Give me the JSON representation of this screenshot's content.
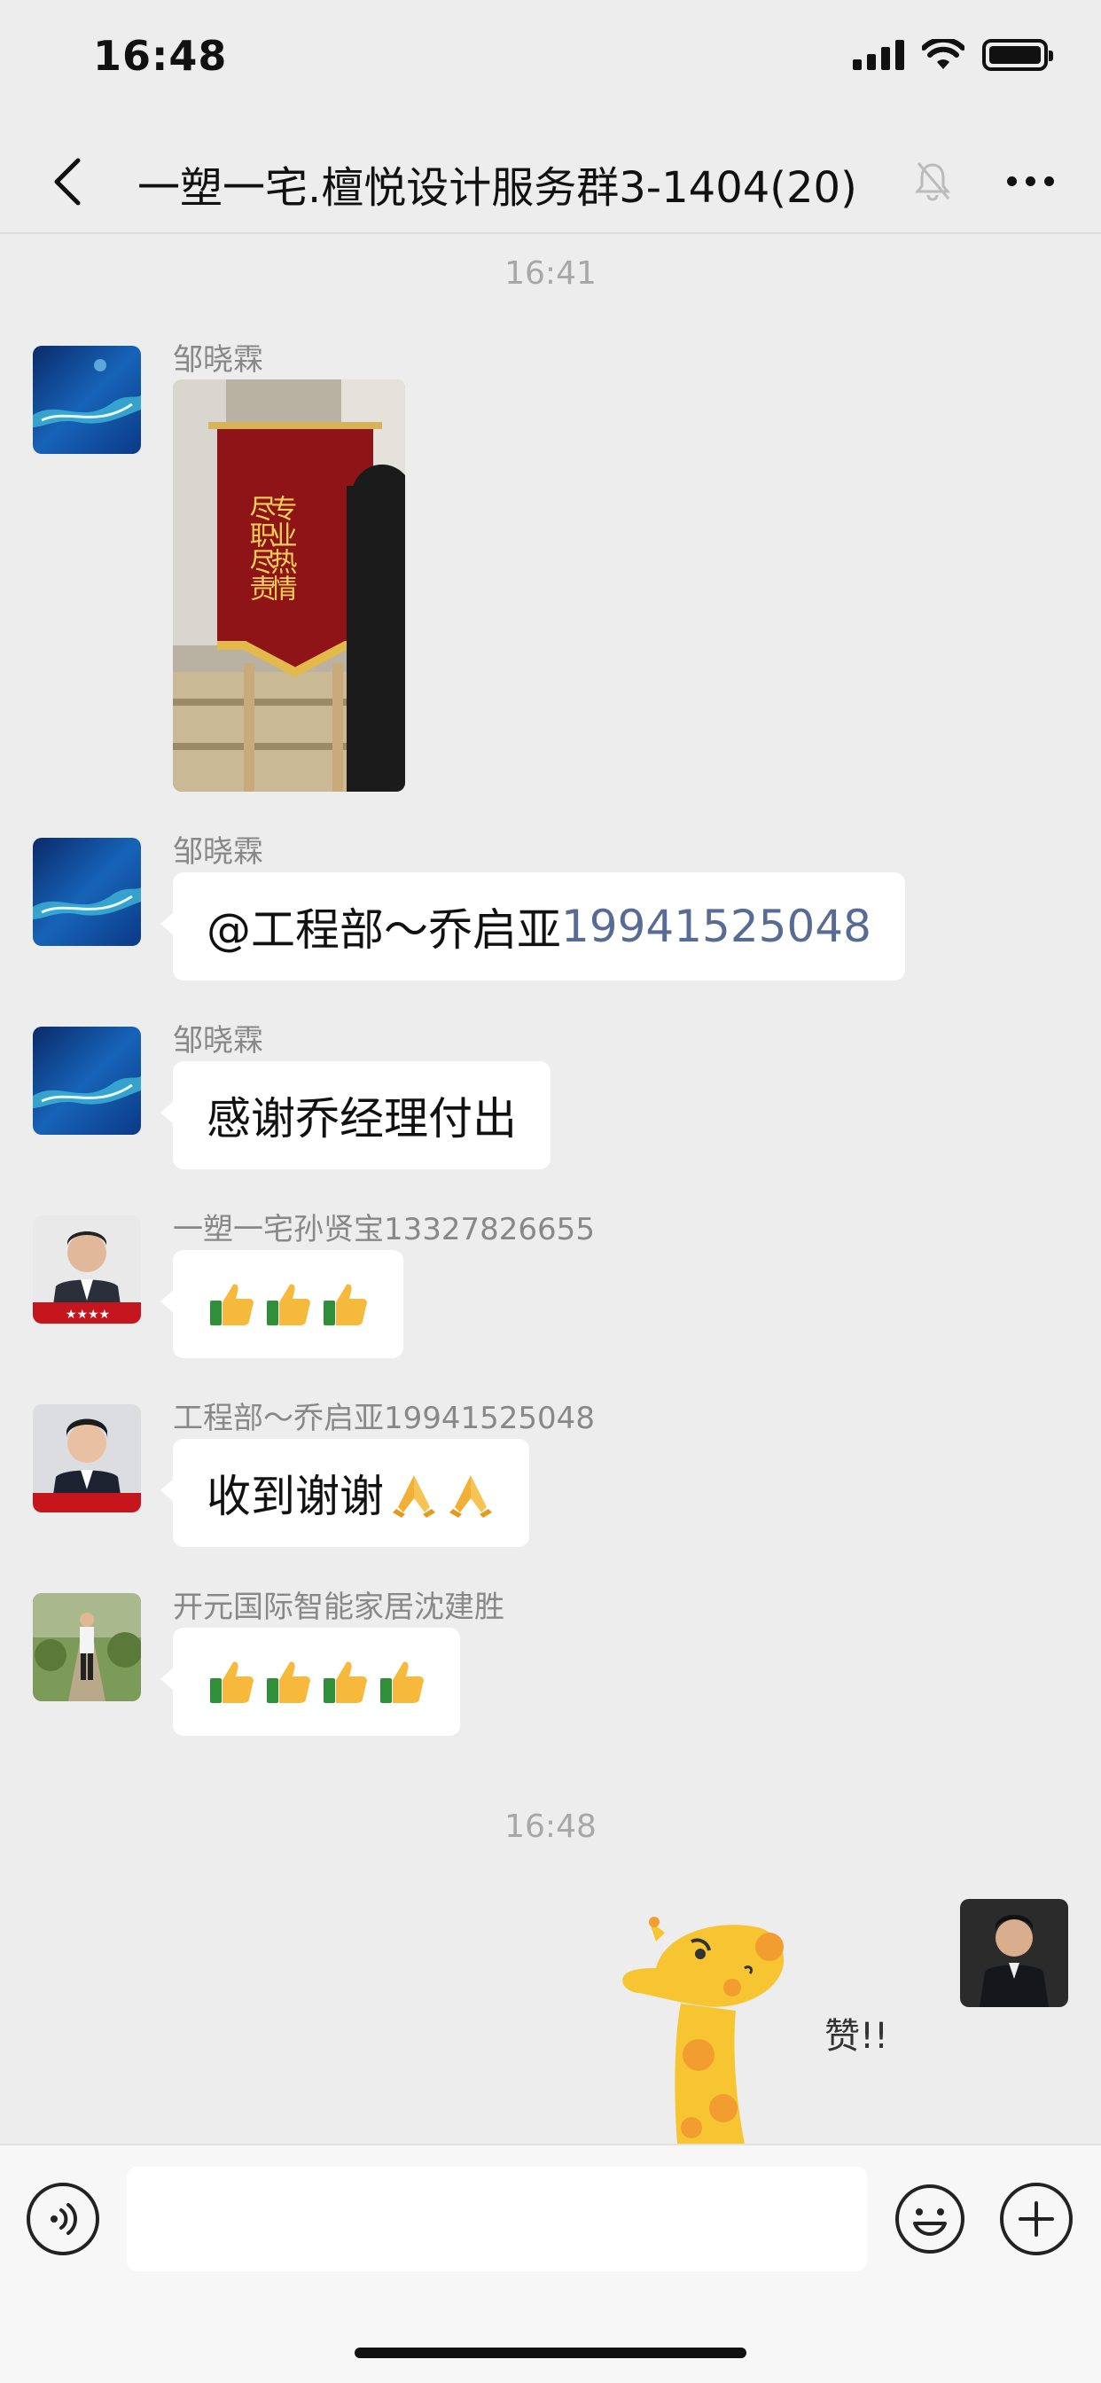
{
  "status_bar": {
    "time": "16:48"
  },
  "header": {
    "title": "一塑一宅.檀悦设计服务群3-1404(20)"
  },
  "timestamps": [
    "16:41",
    "16:48"
  ],
  "messages": [
    {
      "sender": "邹晓霖",
      "type": "image"
    },
    {
      "sender": "邹晓霖",
      "text": "@工程部～乔启亚",
      "mention_number": "19941525048"
    },
    {
      "sender": "邹晓霖",
      "text": "感谢乔经理付出"
    },
    {
      "sender": "一塑一宅孙贤宝13327826655",
      "emoji": [
        "thumbs-up",
        "thumbs-up",
        "thumbs-up"
      ]
    },
    {
      "sender": "工程部～乔启亚19941525048",
      "text": "收到谢谢",
      "emoji": [
        "folded-hands",
        "folded-hands"
      ]
    },
    {
      "sender": "开元国际智能家居沈建胜",
      "emoji": [
        "thumbs-up",
        "thumbs-up",
        "thumbs-up",
        "thumbs-up"
      ]
    }
  ],
  "photo": {
    "banner_line1": "尽职尽责",
    "banner_line2": "专业热情"
  },
  "sticker": {
    "text": "赞!!"
  },
  "input": {
    "value": ""
  },
  "colors": {
    "background": "#ededed",
    "bubble": "#ffffff",
    "mention": "#576b95",
    "timestamp": "#a7a7a7"
  }
}
